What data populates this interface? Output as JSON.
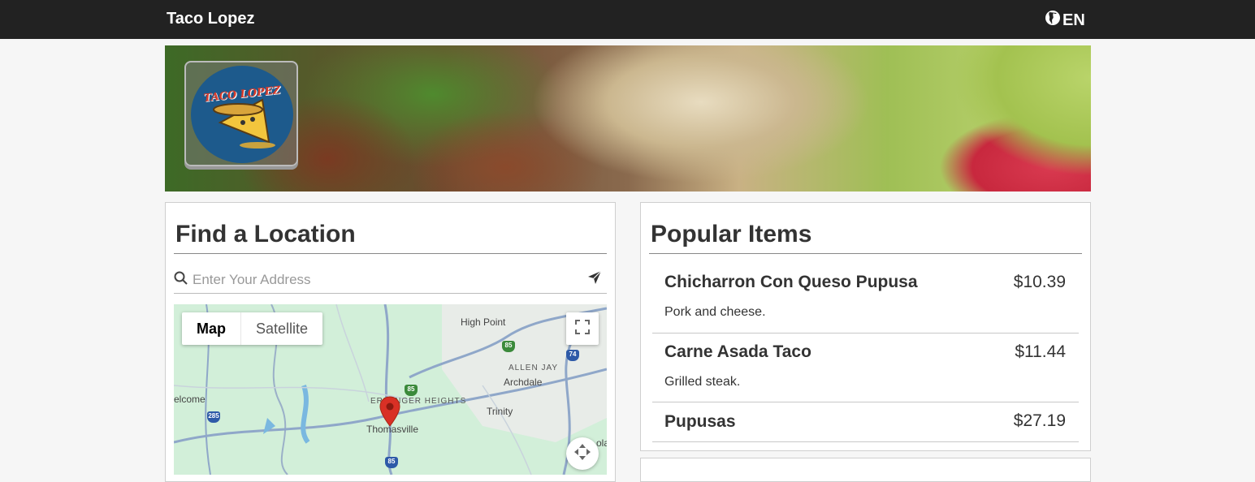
{
  "header": {
    "brand": "Taco Lopez",
    "language": "EN"
  },
  "hero": {
    "logo_text": "TACO LOPEZ"
  },
  "location": {
    "title": "Find a Location",
    "search_placeholder": "Enter Your Address",
    "map": {
      "type_map": "Map",
      "type_satellite": "Satellite",
      "labels": [
        "High Point",
        "ALLEN JAY",
        "Archdale",
        "ERLANGER HEIGHTS",
        "Trinity",
        "Thomasville",
        "elcome",
        "ola"
      ],
      "shields": [
        "85",
        "74",
        "85",
        "285",
        "85"
      ]
    }
  },
  "popular": {
    "title": "Popular Items",
    "items": [
      {
        "name": "Chicharron Con Queso Pupusa",
        "price": "$10.39",
        "desc": "Pork and cheese."
      },
      {
        "name": "Carne Asada Taco",
        "price": "$11.44",
        "desc": "Grilled steak."
      },
      {
        "name": "Pupusas",
        "price": "$27.19",
        "desc": ""
      }
    ]
  },
  "colors": {
    "topbar": "#222222",
    "map_pin": "#d93025",
    "logo_blue": "#1d5a8c"
  }
}
